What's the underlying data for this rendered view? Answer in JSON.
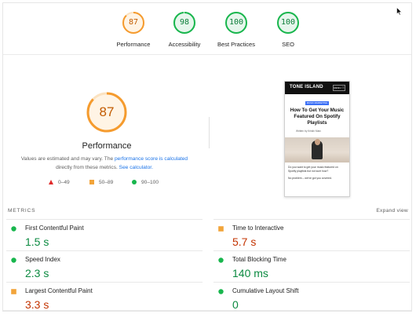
{
  "colors": {
    "orange": "#f59b2e",
    "green": "#18b64d",
    "red": "#e02a2a",
    "link": "#1a73e8"
  },
  "gauges": [
    {
      "score": "87",
      "label": "Performance",
      "status": "orange"
    },
    {
      "score": "98",
      "label": "Accessibility",
      "status": "green"
    },
    {
      "score": "100",
      "label": "Best Practices",
      "status": "green"
    },
    {
      "score": "100",
      "label": "SEO",
      "status": "green"
    }
  ],
  "main": {
    "score": "87",
    "title": "Performance",
    "desc_1": "Values are estimated and may vary. The ",
    "desc_link_1": "performance score is calculated",
    "desc_2": " directly from these metrics. ",
    "desc_link_2": "See calculator."
  },
  "legend": {
    "bad": "0–49",
    "average": "50–89",
    "good": "90–100"
  },
  "screenshot": {
    "brand": "TONE ISLAND",
    "menu": "MENU ☰",
    "tag": "MUSIC MARKETING",
    "title": "How To Get Your Music Featured On Spotify Playlists",
    "author": "Written by Kristin Marc",
    "text_1": "Do you want to get your music featured on Spotify playlists but not sure how?",
    "text_2": "No problem – we've got you covered."
  },
  "metrics": {
    "header": "METRICS",
    "expand": "Expand view",
    "items": [
      {
        "name": "First Contentful Paint",
        "value": "1.5 s",
        "status": "good"
      },
      {
        "name": "Time to Interactive",
        "value": "5.7 s",
        "status": "average"
      },
      {
        "name": "Speed Index",
        "value": "2.3 s",
        "status": "good"
      },
      {
        "name": "Total Blocking Time",
        "value": "140 ms",
        "status": "good"
      },
      {
        "name": "Largest Contentful Paint",
        "value": "3.3 s",
        "status": "average"
      },
      {
        "name": "Cumulative Layout Shift",
        "value": "0",
        "status": "good"
      }
    ]
  }
}
